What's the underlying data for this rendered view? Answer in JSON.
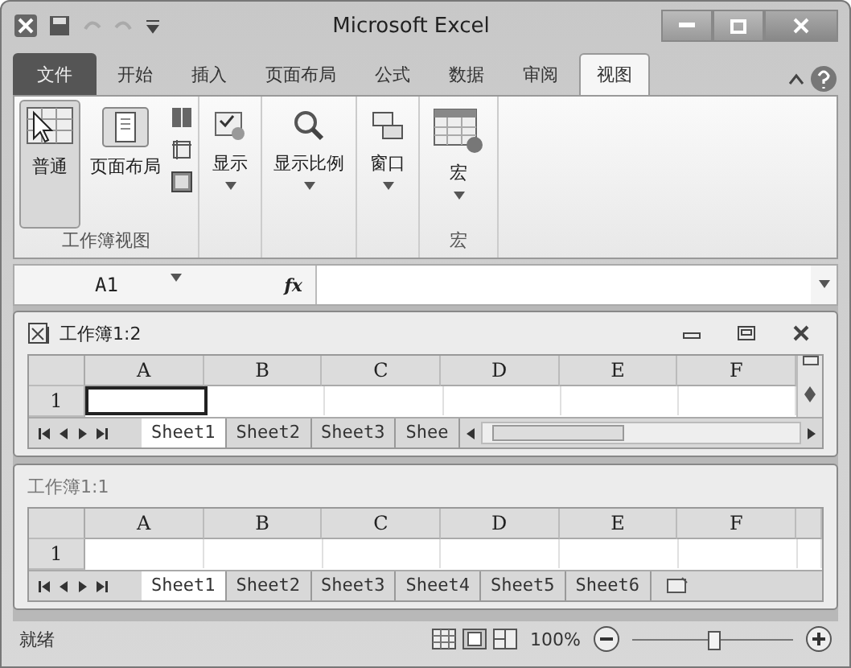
{
  "window": {
    "title": "Microsoft Excel"
  },
  "ribbon_tabs": [
    {
      "label": "文件",
      "kind": "file",
      "selected": false
    },
    {
      "label": "开始",
      "kind": "tab",
      "selected": false
    },
    {
      "label": "插入",
      "kind": "tab",
      "selected": false
    },
    {
      "label": "页面布局",
      "kind": "tab",
      "selected": false
    },
    {
      "label": "公式",
      "kind": "tab",
      "selected": false
    },
    {
      "label": "数据",
      "kind": "tab",
      "selected": false
    },
    {
      "label": "审阅",
      "kind": "tab",
      "selected": false
    },
    {
      "label": "视图",
      "kind": "tab",
      "selected": true
    }
  ],
  "ribbon_groups": [
    {
      "label": "工作簿视图",
      "buttons": [
        {
          "label": "普通",
          "selected": true
        },
        {
          "label": "页面布局",
          "selected": false
        }
      ]
    },
    {
      "buttons": [
        {
          "label": "显示",
          "selected": false
        }
      ]
    },
    {
      "buttons": [
        {
          "label": "显示比例",
          "selected": false
        }
      ]
    },
    {
      "buttons": [
        {
          "label": "窗口",
          "selected": false
        }
      ]
    },
    {
      "label": "宏",
      "buttons": [
        {
          "label": "宏",
          "selected": false
        }
      ]
    }
  ],
  "formula_bar": {
    "name_box": "A1",
    "fx": "fx"
  },
  "workbook_windows": [
    {
      "title": "工作簿1:2",
      "active": true,
      "columns": [
        "A",
        "B",
        "C",
        "D",
        "E",
        "F"
      ],
      "rows": [
        {
          "label": "1",
          "cells": [
            {
              "selected": true
            },
            {
              "selected": false
            },
            {
              "selected": false
            },
            {
              "selected": false
            },
            {
              "selected": false
            },
            {
              "selected": false
            }
          ]
        }
      ],
      "sheet_tabs": [
        {
          "label": "Sheet1",
          "selected": true
        },
        {
          "label": "Sheet2",
          "selected": false
        },
        {
          "label": "Sheet3",
          "selected": false
        },
        {
          "label": "Shee",
          "selected": false
        }
      ]
    },
    {
      "title": "工作簿1:1",
      "active": false,
      "columns": [
        "A",
        "B",
        "C",
        "D",
        "E",
        "F"
      ],
      "rows": [
        {
          "label": "1",
          "cells": [
            {
              "selected": false
            },
            {
              "selected": false
            },
            {
              "selected": false
            },
            {
              "selected": false
            },
            {
              "selected": false
            },
            {
              "selected": false
            }
          ]
        }
      ],
      "sheet_tabs": [
        {
          "label": "Sheet1",
          "selected": true
        },
        {
          "label": "Sheet2",
          "selected": false
        },
        {
          "label": "Sheet3",
          "selected": false
        },
        {
          "label": "Sheet4",
          "selected": false
        },
        {
          "label": "Sheet5",
          "selected": false
        },
        {
          "label": "Sheet6",
          "selected": false
        }
      ]
    }
  ],
  "status_bar": {
    "status": "就绪",
    "zoom": "100%",
    "zoom_level": {
      "level": 0.5
    }
  }
}
